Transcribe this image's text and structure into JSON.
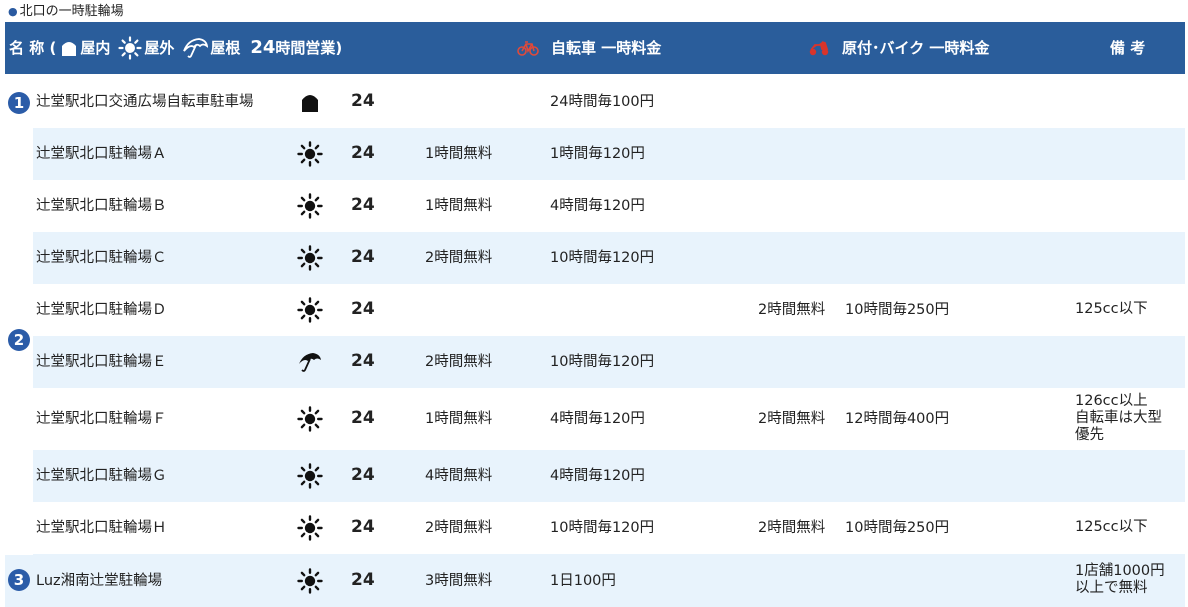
{
  "caption": "北口の一時駐輪場",
  "header": {
    "name_label": "名 称 (",
    "legend": [
      {
        "icon": "indoor-icon",
        "label": "屋内"
      },
      {
        "icon": "sun-icon",
        "label": "屋外"
      },
      {
        "icon": "umbrella-icon",
        "label": "屋根"
      }
    ],
    "hours_number": "24",
    "hours_label": "時間営業)",
    "bicycle_label": "自転車 一時料金",
    "moto_label": "原付･バイク 一時料金",
    "note_label": "備 考",
    "colors": {
      "header_bg": "#2a5d9b",
      "row_alt": "#e8f3fc",
      "badge": "#2b5ca8",
      "moto_icon": "#d9342b"
    }
  },
  "groups": [
    {
      "badge": "1"
    },
    {
      "badge": "2"
    },
    {
      "badge": "3"
    }
  ],
  "rows": [
    {
      "name": "辻堂駅北口交通広場自転車駐車場",
      "icon": "indoor-icon",
      "hours": "24",
      "bike_free": "",
      "bike_fee": "24時間毎100円",
      "moto_free": "",
      "moto_fee": "",
      "note": ""
    },
    {
      "name": "辻堂駅北口駐輪場Ａ",
      "icon": "sun-icon",
      "hours": "24",
      "bike_free": "1時間無料",
      "bike_fee": "1時間毎120円",
      "moto_free": "",
      "moto_fee": "",
      "note": ""
    },
    {
      "name": "辻堂駅北口駐輪場Ｂ",
      "icon": "sun-icon",
      "hours": "24",
      "bike_free": "1時間無料",
      "bike_fee": "4時間毎120円",
      "moto_free": "",
      "moto_fee": "",
      "note": ""
    },
    {
      "name": "辻堂駅北口駐輪場Ｃ",
      "icon": "sun-icon",
      "hours": "24",
      "bike_free": "2時間無料",
      "bike_fee": "10時間毎120円",
      "moto_free": "",
      "moto_fee": "",
      "note": ""
    },
    {
      "name": "辻堂駅北口駐輪場Ｄ",
      "icon": "sun-icon",
      "hours": "24",
      "bike_free": "",
      "bike_fee": "",
      "moto_free": "2時間無料",
      "moto_fee": "10時間毎250円",
      "note": "125cc以下"
    },
    {
      "name": "辻堂駅北口駐輪場Ｅ",
      "icon": "umbrella-icon",
      "hours": "24",
      "bike_free": "2時間無料",
      "bike_fee": "10時間毎120円",
      "moto_free": "",
      "moto_fee": "",
      "note": ""
    },
    {
      "name": "辻堂駅北口駐輪場Ｆ",
      "icon": "sun-icon",
      "hours": "24",
      "bike_free": "1時間無料",
      "bike_fee": "4時間毎120円",
      "moto_free": "2時間無料",
      "moto_fee": "12時間毎400円",
      "note": "126cc以上\n自転車は大型\n優先"
    },
    {
      "name": "辻堂駅北口駐輪場Ｇ",
      "icon": "sun-icon",
      "hours": "24",
      "bike_free": "4時間無料",
      "bike_fee": "4時間毎120円",
      "moto_free": "",
      "moto_fee": "",
      "note": ""
    },
    {
      "name": "辻堂駅北口駐輪場Ｈ",
      "icon": "sun-icon",
      "hours": "24",
      "bike_free": "2時間無料",
      "bike_fee": "10時間毎120円",
      "moto_free": "2時間無料",
      "moto_fee": "10時間毎250円",
      "note": "125cc以下"
    },
    {
      "name": "Luz湘南辻堂駐輪場",
      "icon": "sun-icon",
      "hours": "24",
      "bike_free": "3時間無料",
      "bike_fee": "1日100円",
      "moto_free": "",
      "moto_fee": "",
      "note": "1店舗1000円\n以上で無料"
    }
  ]
}
